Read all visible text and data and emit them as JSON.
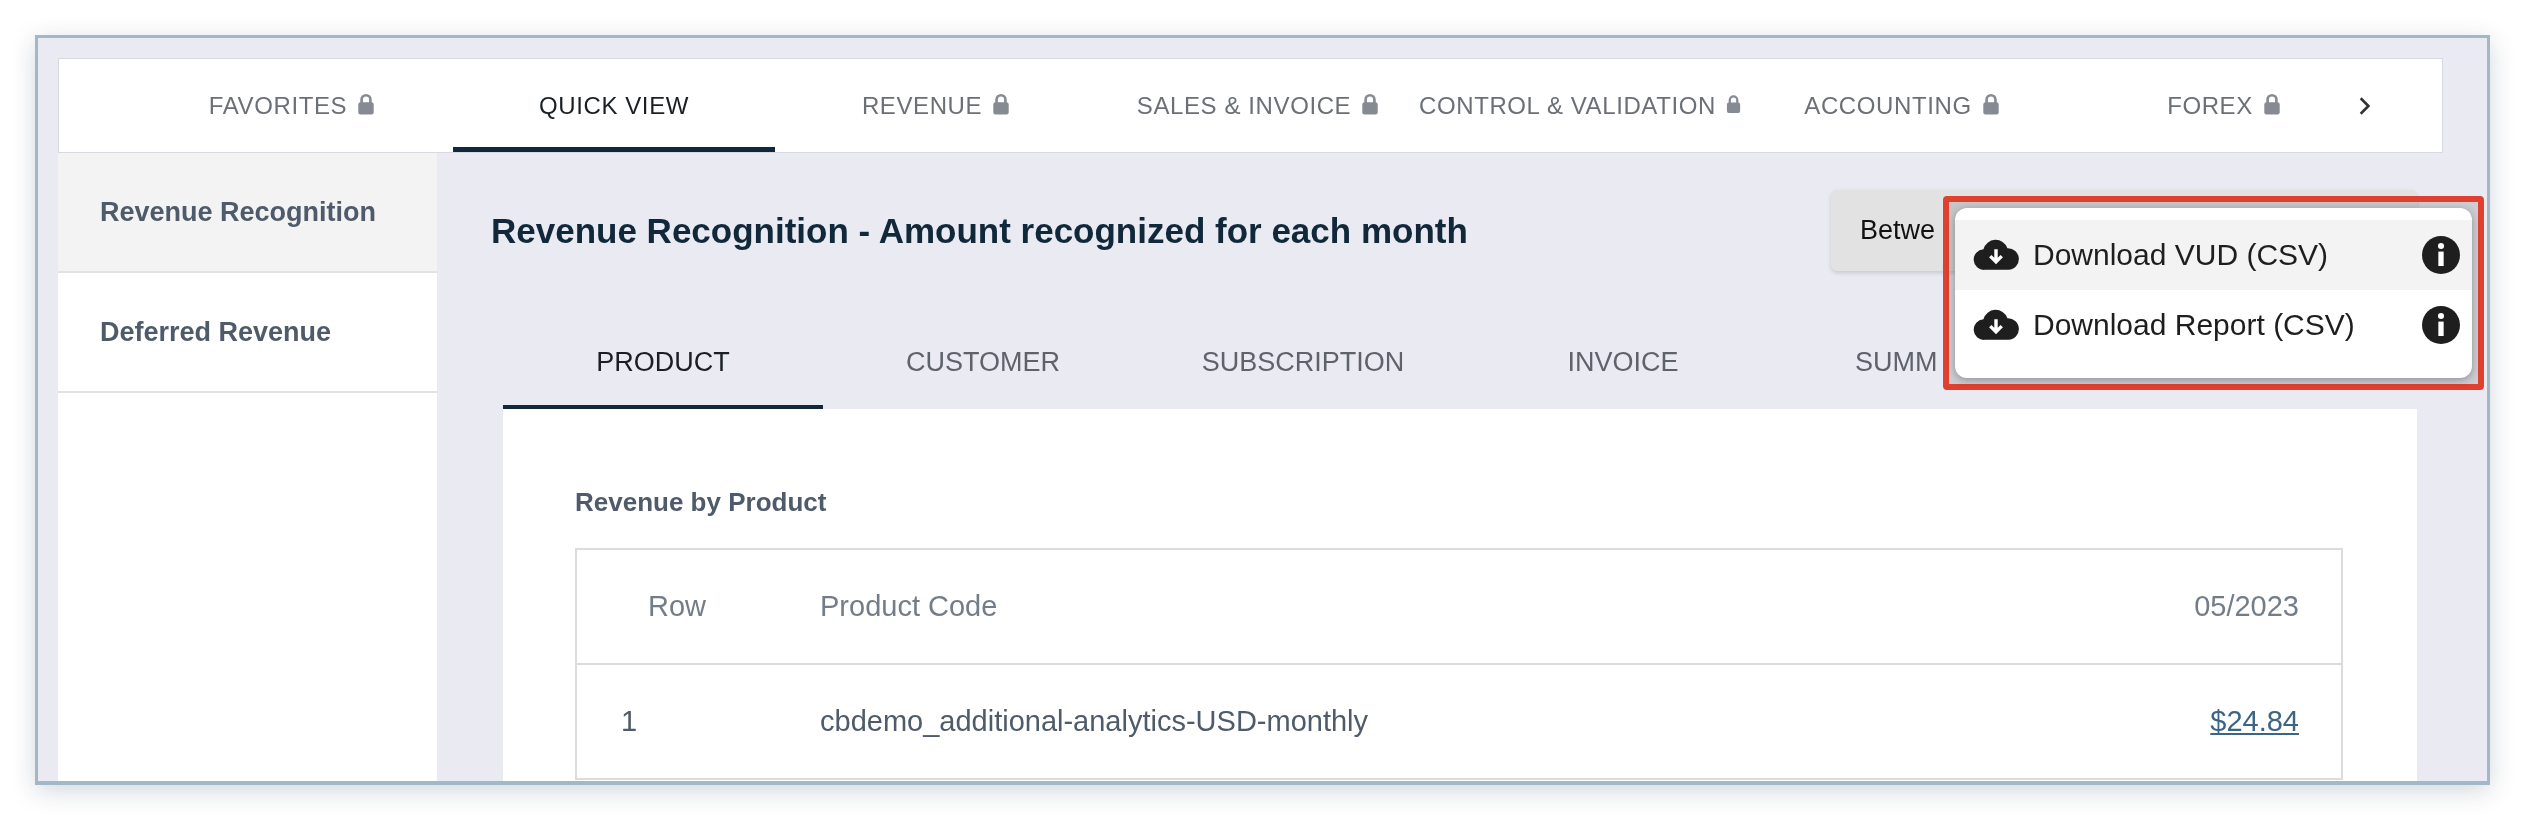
{
  "top_tabs": [
    {
      "label": "FAVORITES",
      "locked": true,
      "selected": false
    },
    {
      "label": "QUICK VIEW",
      "locked": false,
      "selected": true
    },
    {
      "label": "REVENUE",
      "locked": true,
      "selected": false
    },
    {
      "label": "SALES & INVOICE",
      "locked": true,
      "selected": false
    },
    {
      "label": "CONTROL & VALIDATION",
      "locked": true,
      "selected": false
    },
    {
      "label": "ACCOUNTING",
      "locked": true,
      "selected": false
    },
    {
      "label": "FOREX",
      "locked": true,
      "selected": false
    }
  ],
  "sidebar": {
    "items": [
      {
        "label": "Revenue Recognition",
        "selected": true
      },
      {
        "label": "Deferred Revenue",
        "selected": false
      }
    ]
  },
  "page_title": "Revenue Recognition - Amount recognized for each month",
  "date_button": "Betwe",
  "sub_tabs": [
    {
      "label": "PRODUCT",
      "selected": true
    },
    {
      "label": "CUSTOMER",
      "selected": false
    },
    {
      "label": "SUBSCRIPTION",
      "selected": false
    },
    {
      "label": "INVOICE",
      "selected": false
    },
    {
      "label": "SUMM",
      "selected": false
    }
  ],
  "section_title": "Revenue by Product",
  "table": {
    "columns": [
      "Row",
      "Product Code",
      "05/2023"
    ],
    "rows": [
      [
        "1",
        "cbdemo_additional-analytics-USD-monthly",
        "$24.84"
      ]
    ]
  },
  "download_menu": {
    "items": [
      {
        "label": "Download VUD (CSV)",
        "highlighted": true
      },
      {
        "label": "Download Report (CSV)",
        "highlighted": false
      }
    ]
  }
}
